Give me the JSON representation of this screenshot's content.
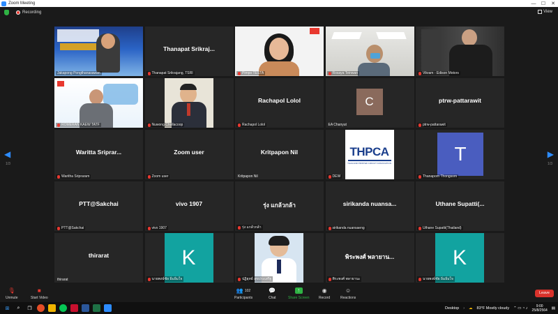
{
  "window": {
    "title": "Zoom Meeting",
    "min": "—",
    "max": "☐",
    "close": "✕"
  },
  "topbar": {
    "recording": "Recording",
    "view": "View"
  },
  "pager": {
    "left": "1/3",
    "right": "1/3"
  },
  "tiles": [
    {
      "label": "Jakapong Pongthanasawan",
      "bigname": ""
    },
    {
      "label": "Thanapat Srikrajang, TSRI",
      "bigname": "Thanapat Srikraj..."
    },
    {
      "label": "Pimpo TESTA",
      "bigname": ""
    },
    {
      "label": "Rosaya Teinwan",
      "bigname": ""
    },
    {
      "label": "Vikram - Edison Motors",
      "bigname": ""
    },
    {
      "label": "ROMERAN KAEW TATF",
      "bigname": ""
    },
    {
      "label": "Nuwong Chollacoop",
      "bigname": ""
    },
    {
      "label": "Rachapol Lolol",
      "bigname": "Rachapol Lolol"
    },
    {
      "label": "EA Chanyut",
      "bigname": "",
      "avatar": "C"
    },
    {
      "label": "ptrw-pattarawit",
      "bigname": "ptrw-pattarawit"
    },
    {
      "label": "Waritha Sripraram",
      "bigname": "Waritta Sriprar..."
    },
    {
      "label": "Zoom user",
      "bigname": "Zoom user"
    },
    {
      "label": "Kritpapon Nil",
      "bigname": "Kritpapon Nil"
    },
    {
      "label": "DEW",
      "bigname": "",
      "logo": "THPCA",
      "logo_sub": "THAILAND PRINTED CIRCUIT ASSOCIATION"
    },
    {
      "label": "Thanaporn Thongsom",
      "bigname": "",
      "avatar": "T"
    },
    {
      "label": "PTT@Sakchai",
      "bigname": "PTT@Sakchai"
    },
    {
      "label": "vivo 1907",
      "bigname": "vivo 1907"
    },
    {
      "label": "รุ่ง แกล้วกล้า",
      "bigname": "รุ่ง แกล้วกล้า"
    },
    {
      "label": "sirikanda nuansaeng",
      "bigname": "sirikanda nuansa..."
    },
    {
      "label": "Uthane Supatti(Thailand)",
      "bigname": "Uthane Supatti(..."
    },
    {
      "label": "thirarat",
      "bigname": "thirarat"
    },
    {
      "label": "นายพงษ์ชัย อิ่มอิ่มใจ",
      "bigname": "",
      "avatar": "K"
    },
    {
      "label": "ปฏิยุทธ์ สุขประเสริฐ",
      "bigname": ""
    },
    {
      "label": "พิระพงศ์ พลายานะ",
      "bigname": "พิระพงศ์ พลายาน..."
    },
    {
      "label": "นายพงษ์ชัย อิ่มอิ่มใจ",
      "bigname": "",
      "avatar": "K"
    }
  ],
  "toolbar": {
    "unmute": "Unmute",
    "start_video": "Start Video",
    "participants": "Participants",
    "participants_count": "102",
    "chat": "Chat",
    "share_screen": "Share Screen",
    "record": "Record",
    "reactions": "Reactions",
    "leave": "Leave"
  },
  "taskbar": {
    "desktop": "Desktop",
    "weather": "83°F  Mostly cloudy",
    "time": "9:00",
    "date": "25/8/2564"
  },
  "colors": {
    "active_speaker": "#d9d600",
    "leave": "#d9322b",
    "share": "#2fb344",
    "accent": "#2d8cff"
  }
}
